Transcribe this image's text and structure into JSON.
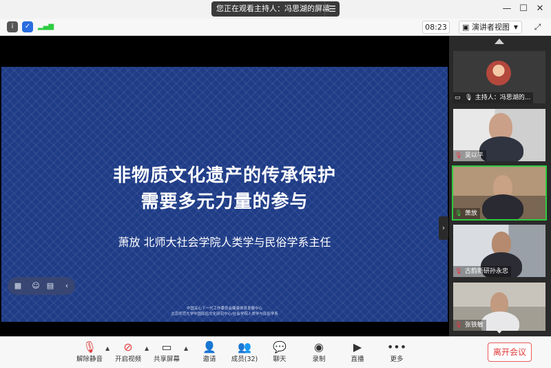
{
  "titlebar": {
    "share_notice": "您正在观看主持人：冯思湖的屏幕",
    "menu_icon": "menu-icon"
  },
  "infobar": {
    "timer": "08:23",
    "view_mode": "演讲者视图"
  },
  "slide": {
    "title_line1": "非物质文化遗产的传承保护",
    "title_line2": "需要多元力量的参与",
    "speaker": "萧放   北师大社会学院人类学与民俗学系主任",
    "footer_line1": "中国关心下一代工作委员会健康体育发展中心",
    "footer_line2": "北京师范大学中国民俗文化研究中心/社会学院人类学与民俗学系"
  },
  "participants": [
    {
      "name": "主持人：冯思湖的...",
      "mic": "on",
      "video": "avatar"
    },
    {
      "name": "吴以平",
      "mic": "muted",
      "video": "camera"
    },
    {
      "name": "萧放",
      "mic": "on",
      "video": "camera",
      "active": true
    },
    {
      "name": "古韵新研孙永忠",
      "mic": "muted",
      "video": "camera"
    },
    {
      "name": "张铁敏",
      "mic": "muted",
      "video": "camera"
    }
  ],
  "toolbar": {
    "mute": "解除静音",
    "video": "开启视频",
    "share": "共享屏幕",
    "invite": "邀请",
    "members": "成员(32)",
    "chat": "聊天",
    "record": "录制",
    "live": "直播",
    "more": "更多",
    "leave": "离开会议"
  },
  "colors": {
    "slide_bg": "#1f3c87",
    "leave_red": "#e03b3b",
    "active_border": "#2ecc40"
  }
}
